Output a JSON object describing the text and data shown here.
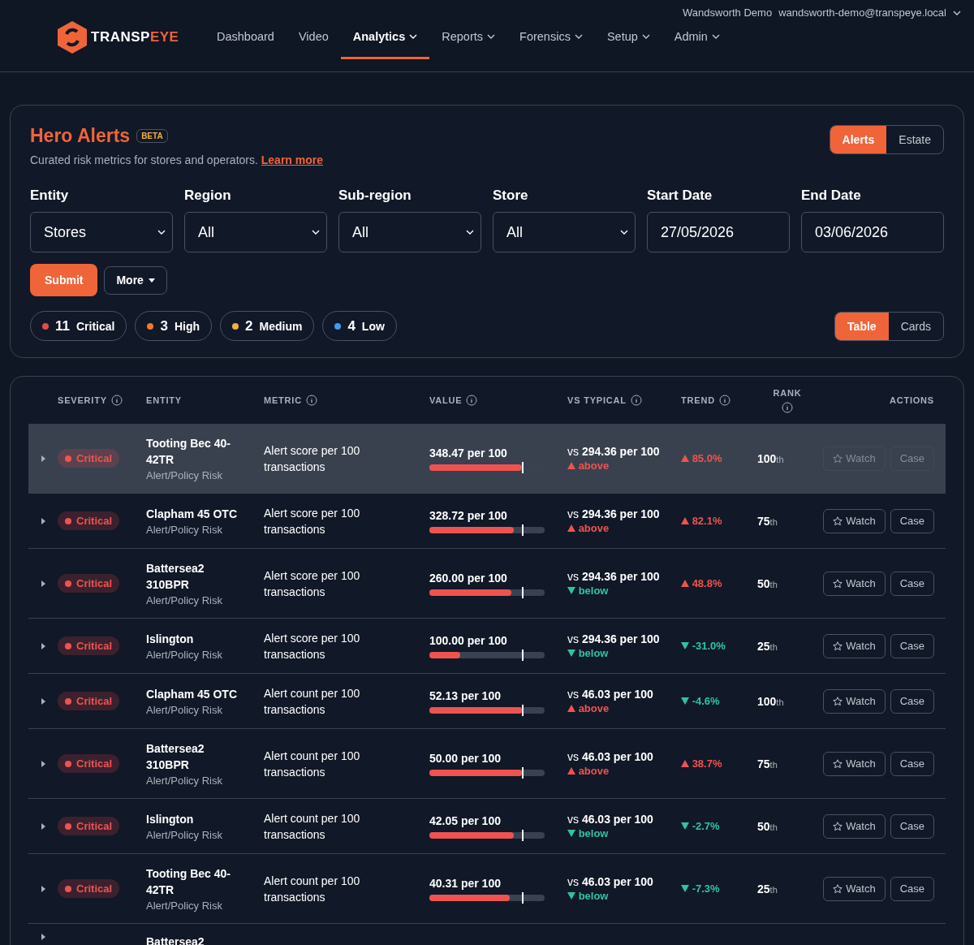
{
  "header": {
    "logo": {
      "text_main": "TRANSP",
      "text_accent": "EYE"
    },
    "user": {
      "account": "Wandsworth Demo",
      "email": "wandsworth-demo@transpeye.local"
    },
    "nav": [
      {
        "label": "Dashboard",
        "selected": false,
        "dropdown": false
      },
      {
        "label": "Video",
        "selected": false,
        "dropdown": false
      },
      {
        "label": "Analytics",
        "selected": true,
        "dropdown": true
      },
      {
        "label": "Reports",
        "selected": false,
        "dropdown": true
      },
      {
        "label": "Forensics",
        "selected": false,
        "dropdown": true
      },
      {
        "label": "Setup",
        "selected": false,
        "dropdown": true
      },
      {
        "label": "Admin",
        "selected": false,
        "dropdown": true
      }
    ]
  },
  "filters_panel": {
    "title": "Hero Alerts",
    "badge": "BETA",
    "subtitle": "Curated risk metrics for stores and operators.",
    "link": "Learn more",
    "mode_toggle": [
      {
        "label": "Alerts",
        "selected": true
      },
      {
        "label": "Estate",
        "selected": false
      }
    ],
    "fields": [
      {
        "label": "Entity",
        "kind": "select",
        "value": "Stores"
      },
      {
        "label": "Region",
        "kind": "select",
        "value": "All"
      },
      {
        "label": "Sub-region",
        "kind": "select",
        "value": "All"
      },
      {
        "label": "Store",
        "kind": "select",
        "value": "All"
      },
      {
        "label": "Start Date",
        "kind": "date",
        "value": "27/05/2026"
      },
      {
        "label": "End Date",
        "kind": "date",
        "value": "03/06/2026"
      }
    ],
    "submit": "Submit",
    "more": "More",
    "severity_counts": [
      {
        "count": "11",
        "label": "Critical",
        "color": "#e5484d"
      },
      {
        "count": "3",
        "label": "High",
        "color": "#f07a2c"
      },
      {
        "count": "2",
        "label": "Medium",
        "color": "#f2b13c"
      },
      {
        "count": "4",
        "label": "Low",
        "color": "#3b9cf0"
      }
    ],
    "view_toggle": [
      {
        "label": "Table",
        "selected": true
      },
      {
        "label": "Cards",
        "selected": false
      }
    ]
  },
  "table": {
    "columns": [
      {
        "label": "SEVERITY",
        "info": true
      },
      {
        "label": "ENTITY",
        "info": false
      },
      {
        "label": "METRIC",
        "info": true
      },
      {
        "label": "VALUE",
        "info": true
      },
      {
        "label": "VS TYPICAL",
        "info": true
      },
      {
        "label": "TREND",
        "info": true
      },
      {
        "label": "RANK",
        "info": true
      },
      {
        "label": "ACTIONS",
        "info": false
      }
    ],
    "rows": [
      {
        "selected": true,
        "severity": "Critical",
        "entity": "Tooting Bec 40-42TR",
        "category": "Alert/Policy Risk",
        "metric": "Alert score per 100 transactions",
        "value": "348.47 per 100",
        "level": 0.8,
        "vs_prefix": "vs",
        "typical": "294.36 per 100",
        "comparison": "above",
        "trend": {
          "text": "85.0%",
          "kind": "up"
        },
        "rank": "100",
        "rank_suffix": "th",
        "watch": "Watch",
        "case": "Case"
      },
      {
        "selected": false,
        "severity": "Critical",
        "entity": "Clapham 45 OTC",
        "category": "Alert/Policy Risk",
        "metric": "Alert score per 100 transactions",
        "value": "328.72 per 100",
        "level": 0.73,
        "vs_prefix": "vs",
        "typical": "294.36 per 100",
        "comparison": "above",
        "trend": {
          "text": "82.1%",
          "kind": "up"
        },
        "rank": "75",
        "rank_suffix": "th",
        "watch": "Watch",
        "case": "Case"
      },
      {
        "selected": false,
        "severity": "Critical",
        "entity": "Battersea2 310BPR",
        "category": "Alert/Policy Risk",
        "metric": "Alert score per 100 transactions",
        "value": "260.00 per 100",
        "level": 0.71,
        "vs_prefix": "vs",
        "typical": "294.36 per 100",
        "comparison": "below",
        "trend": {
          "text": "48.8%",
          "kind": "up"
        },
        "rank": "50",
        "rank_suffix": "th",
        "watch": "Watch",
        "case": "Case"
      },
      {
        "selected": false,
        "severity": "Critical",
        "entity": "Islington",
        "category": "Alert/Policy Risk",
        "metric": "Alert score per 100 transactions",
        "value": "100.00 per 100",
        "level": 0.27,
        "vs_prefix": "vs",
        "typical": "294.36 per 100",
        "comparison": "below",
        "trend": {
          "text": "-31.0%",
          "kind": "down"
        },
        "rank": "25",
        "rank_suffix": "th",
        "watch": "Watch",
        "case": "Case"
      },
      {
        "selected": false,
        "severity": "Critical",
        "entity": "Clapham 45 OTC",
        "category": "Alert/Policy Risk",
        "metric": "Alert count per 100 transactions",
        "value": "52.13 per 100",
        "level": 0.8,
        "vs_prefix": "vs",
        "typical": "46.03 per 100",
        "comparison": "above",
        "trend": {
          "text": "-4.6%",
          "kind": "down"
        },
        "rank": "100",
        "rank_suffix": "th",
        "watch": "Watch",
        "case": "Case"
      },
      {
        "selected": false,
        "severity": "Critical",
        "entity": "Battersea2 310BPR",
        "category": "Alert/Policy Risk",
        "metric": "Alert count per 100 transactions",
        "value": "50.00 per 100",
        "level": 0.8,
        "vs_prefix": "vs",
        "typical": "46.03 per 100",
        "comparison": "above",
        "trend": {
          "text": "38.7%",
          "kind": "up"
        },
        "rank": "75",
        "rank_suffix": "th",
        "watch": "Watch",
        "case": "Case"
      },
      {
        "selected": false,
        "severity": "Critical",
        "entity": "Islington",
        "category": "Alert/Policy Risk",
        "metric": "Alert count per 100 transactions",
        "value": "42.05 per 100",
        "level": 0.73,
        "vs_prefix": "vs",
        "typical": "46.03 per 100",
        "comparison": "below",
        "trend": {
          "text": "-2.7%",
          "kind": "down"
        },
        "rank": "50",
        "rank_suffix": "th",
        "watch": "Watch",
        "case": "Case"
      },
      {
        "selected": false,
        "severity": "Critical",
        "entity": "Tooting Bec 40-42TR",
        "category": "Alert/Policy Risk",
        "metric": "Alert count per 100 transactions",
        "value": "40.31 per 100",
        "level": 0.7,
        "vs_prefix": "vs",
        "typical": "46.03 per 100",
        "comparison": "below",
        "trend": {
          "text": "-7.3%",
          "kind": "down"
        },
        "rank": "25",
        "rank_suffix": "th",
        "watch": "Watch",
        "case": "Case"
      },
      {
        "selected": false,
        "entity": "Battersea2"
      }
    ]
  }
}
